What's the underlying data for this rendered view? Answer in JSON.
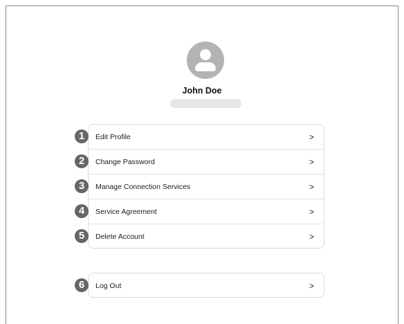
{
  "profile": {
    "name": "John Doe",
    "avatar_icon": "user-avatar-icon"
  },
  "menu": {
    "items": [
      {
        "marker": "1",
        "label": "Edit Profile",
        "chevron": ">"
      },
      {
        "marker": "2",
        "label": "Change Password",
        "chevron": ">"
      },
      {
        "marker": "3",
        "label": "Manage Connection Services",
        "chevron": ">"
      },
      {
        "marker": "4",
        "label": "Service Agreement",
        "chevron": ">"
      },
      {
        "marker": "5",
        "label": "Delete Account",
        "chevron": ">"
      }
    ],
    "logout": {
      "marker": "6",
      "label": "Log Out",
      "chevron": ">"
    }
  },
  "colors": {
    "avatar": "#b3b3b3",
    "marker": "#666666",
    "border": "#d9d9d9"
  }
}
